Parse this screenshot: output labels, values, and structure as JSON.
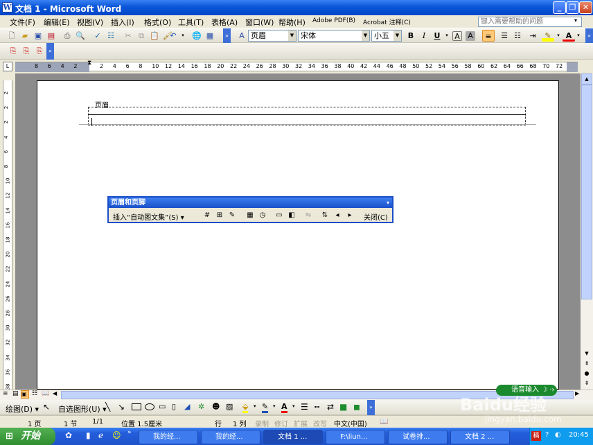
{
  "window": {
    "title": "文档 1 - Microsoft Word"
  },
  "menu": [
    "文件(F)",
    "编辑(E)",
    "视图(V)",
    "插入(I)",
    "格式(O)",
    "工具(T)",
    "表格(A)",
    "窗口(W)",
    "帮助(H)",
    "Adobe PDF(B)",
    "Acrobat 注释(C)"
  ],
  "help_placeholder": "键入需要帮助的问题",
  "format": {
    "style": "页眉",
    "font": "宋体",
    "size": "小五",
    "bold": "B",
    "italic": "I",
    "underline": "U"
  },
  "ruler": {
    "h_ticks": [
      "8",
      "6",
      "4",
      "2",
      "",
      "2",
      "4",
      "6",
      "8",
      "10",
      "12",
      "14",
      "16",
      "18",
      "20",
      "22",
      "24",
      "26",
      "28",
      "30",
      "32",
      "34",
      "36",
      "38",
      "40",
      "42",
      "44",
      "46",
      "48",
      "50",
      "52",
      "54",
      "56",
      "58",
      "60",
      "62",
      "64",
      "66",
      "68",
      "70",
      "72"
    ],
    "v_ticks": [
      "2",
      "2",
      "2",
      "4",
      "6",
      "8",
      "10",
      "12",
      "14",
      "16",
      "18",
      "20",
      "22",
      "24",
      "26",
      "28",
      "30",
      "32",
      "34",
      "36",
      "38"
    ]
  },
  "header": {
    "label": "页眉"
  },
  "hf_toolbar": {
    "title": "页眉和页脚",
    "insert_autotext": "插入“自动图文集”(S)",
    "close": "关闭(C)"
  },
  "drawbar": {
    "draw": "绘图(D)",
    "autoshapes": "自选图形(U)"
  },
  "status": {
    "page": "1 页",
    "section": "1 节",
    "pages": "1/1",
    "position": "位置 1.5厘米",
    "line": "行",
    "col": "1 列",
    "rec": "录制",
    "trk": "修订",
    "ext": "扩展",
    "ovr": "改写",
    "lang": "中文(中国)"
  },
  "taskbar": {
    "start": "开始",
    "tasks": [
      "我的经...",
      "我的经...",
      "文档 1 ...",
      "F:\\liun...",
      "试卷排...",
      "文档 2 ..."
    ],
    "clock": "20:45"
  },
  "ime": {
    "label": "语音输入"
  },
  "watermark": {
    "text": "Baidu经验",
    "url": "jingyan.baidu.com"
  },
  "colors": {
    "title_blue": "#0a56d8",
    "taskbar_blue": "#245edb",
    "start_green": "#3c9c3c"
  }
}
